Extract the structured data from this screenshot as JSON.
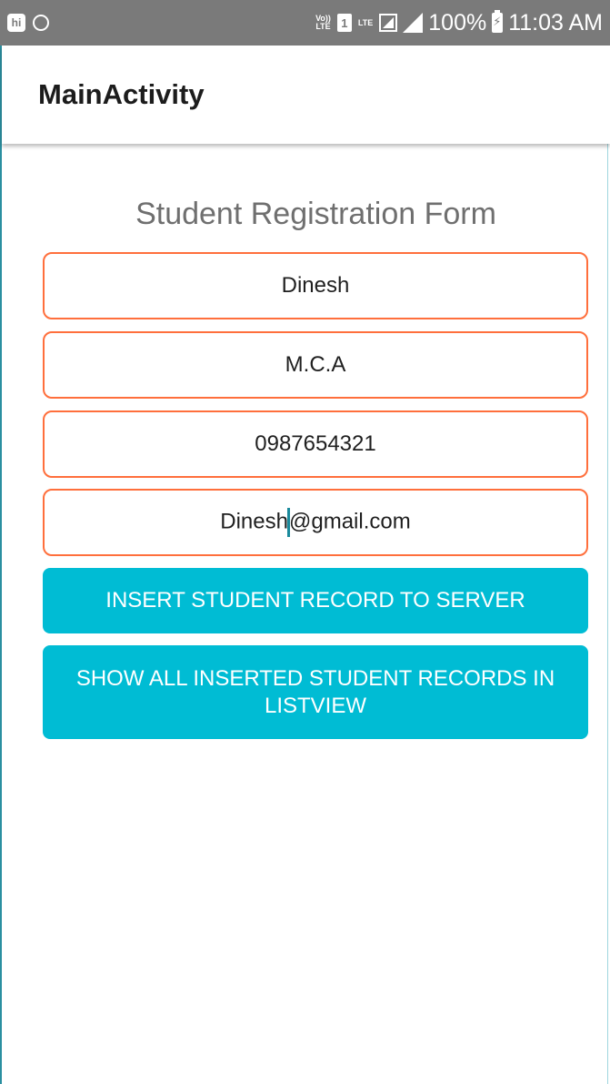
{
  "status_bar": {
    "volte": "Vo))\nLTE",
    "sim_slot": "1",
    "network": "LTE",
    "battery_percent": "100%",
    "time": "11:03 AM"
  },
  "app_bar": {
    "title": "MainActivity"
  },
  "form": {
    "title": "Student Registration Form",
    "name": "Dinesh",
    "course": "M.C.A",
    "phone": "0987654321",
    "email_before_cursor": "Dinesh",
    "email_after_cursor": "@gmail.com"
  },
  "buttons": {
    "insert": "INSERT STUDENT RECORD TO SERVER",
    "show_all": "SHOW ALL INSERTED STUDENT RECORDS IN LISTVIEW"
  },
  "colors": {
    "accent": "#00bcd4",
    "field_border": "#ff6f3c",
    "status_bar": "#7a7a7a"
  }
}
